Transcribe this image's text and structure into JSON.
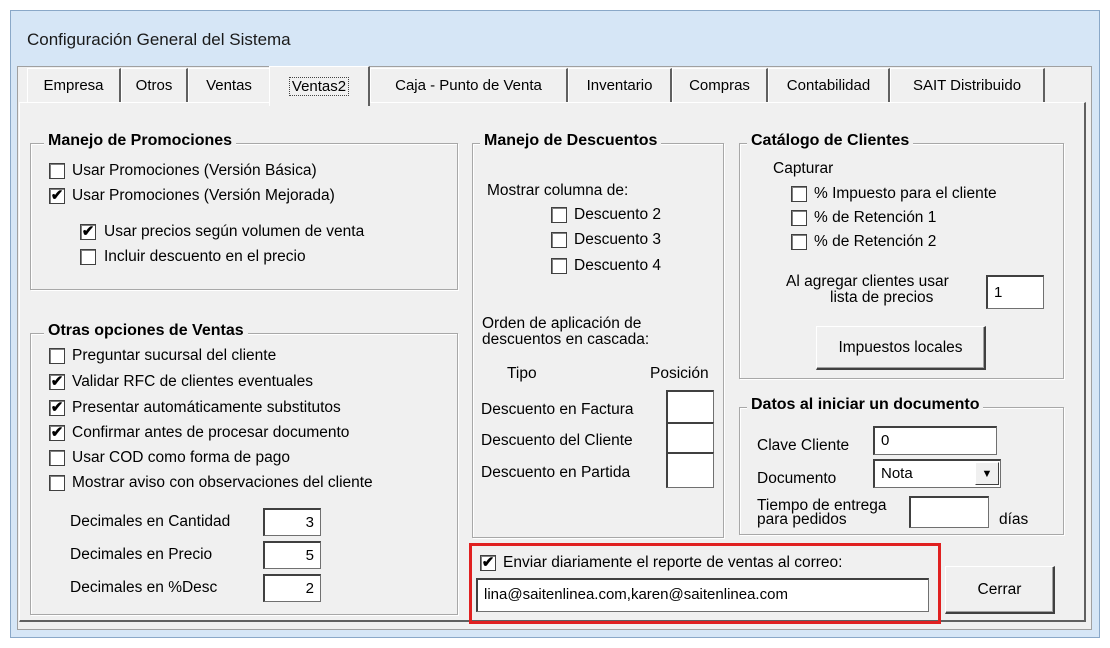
{
  "window": {
    "title": "Configuración General del Sistema"
  },
  "tabs": [
    {
      "label": "Empresa"
    },
    {
      "label": "Otros"
    },
    {
      "label": "Ventas"
    },
    {
      "label": "Ventas2",
      "active": true
    },
    {
      "label": "Caja - Punto de Venta"
    },
    {
      "label": "Inventario"
    },
    {
      "label": "Compras"
    },
    {
      "label": "Contabilidad"
    },
    {
      "label": "SAIT Distribuido"
    }
  ],
  "promociones": {
    "title": "Manejo de Promociones",
    "items": [
      {
        "label": "Usar Promociones (Versión Básica)",
        "checked": false
      },
      {
        "label": "Usar Promociones (Versión Mejorada)",
        "checked": true
      },
      {
        "label": "Usar precios según volumen de venta",
        "checked": true
      },
      {
        "label": "Incluir descuento en el precio",
        "checked": false
      }
    ]
  },
  "otras": {
    "title": "Otras opciones de Ventas",
    "items": [
      {
        "label": "Preguntar sucursal del cliente",
        "checked": false
      },
      {
        "label": "Validar RFC de clientes eventuales",
        "checked": true
      },
      {
        "label": "Presentar automáticamente substitutos",
        "checked": true
      },
      {
        "label": "Confirmar antes de procesar documento",
        "checked": true
      },
      {
        "label": "Usar COD como forma de pago",
        "checked": false
      },
      {
        "label": "Mostrar aviso con observaciones del cliente",
        "checked": false
      }
    ],
    "decimals": [
      {
        "label": "Decimales en Cantidad",
        "value": "3"
      },
      {
        "label": "Decimales en Precio",
        "value": "5"
      },
      {
        "label": "Decimales en %Desc",
        "value": "2"
      }
    ]
  },
  "descuentos": {
    "title": "Manejo de Descuentos",
    "mostrar_label": "Mostrar columna de:",
    "items": [
      {
        "label": "Descuento 2",
        "checked": false
      },
      {
        "label": "Descuento 3",
        "checked": false
      },
      {
        "label": "Descuento 4",
        "checked": false
      }
    ],
    "orden_label_1": "Orden de aplicación de",
    "orden_label_2": "descuentos en cascada:",
    "tipo_header": "Tipo",
    "posicion_header": "Posición",
    "rows": [
      {
        "label": "Descuento en Factura",
        "value": ""
      },
      {
        "label": "Descuento del Cliente",
        "value": ""
      },
      {
        "label": "Descuento en Partida",
        "value": ""
      }
    ]
  },
  "clientes": {
    "title": "Catálogo de Clientes",
    "capturar_label": "Capturar",
    "items": [
      {
        "label": "% Impuesto para el cliente",
        "checked": false
      },
      {
        "label": "% de Retención 1",
        "checked": false
      },
      {
        "label": "% de Retención 2",
        "checked": false
      }
    ],
    "lista_label_1": "Al agregar clientes usar",
    "lista_label_2": "lista de precios",
    "lista_value": "1",
    "impuestos_button": "Impuestos locales"
  },
  "datos": {
    "title": "Datos al iniciar un documento",
    "clave_label": "Clave Cliente",
    "clave_value": "0",
    "documento_label": "Documento",
    "documento_value": "Nota",
    "tiempo_label_1": "Tiempo de entrega",
    "tiempo_label_2": "para pedidos",
    "tiempo_value": "",
    "dias_label": "días"
  },
  "reporte": {
    "label": "Enviar diariamente el reporte de ventas al correo:",
    "checked": true,
    "email": "lina@saitenlinea.com,karen@saitenlinea.com"
  },
  "cerrar_button": "Cerrar",
  "highlight_color": "#e02020"
}
